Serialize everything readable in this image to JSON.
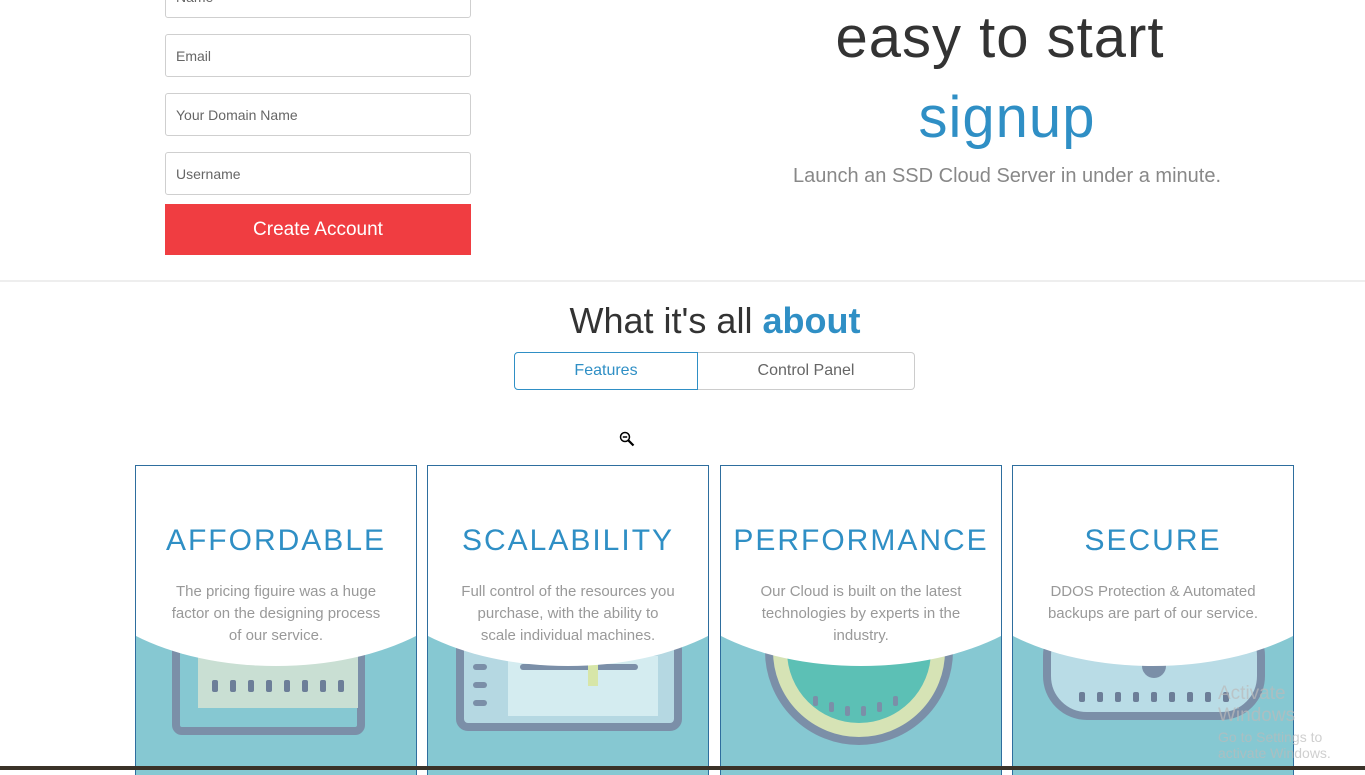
{
  "form": {
    "name_placeholder": "Name",
    "email_placeholder": "Email",
    "domain_placeholder": "Your Domain Name",
    "username_placeholder": "Username",
    "create_label": "Create Account"
  },
  "hero": {
    "line1": "easy to start",
    "line2": "signup",
    "subtitle": "Launch an SSD Cloud Server in under a minute."
  },
  "about": {
    "title_prefix": "What it's all",
    "title_accent": "about",
    "tabs": [
      {
        "label": "Features",
        "active": true
      },
      {
        "label": "Control Panel",
        "active": false
      }
    ]
  },
  "features": [
    {
      "title": "AFFORDABLE",
      "desc": "The pricing figuire was a huge factor on the designing process of our service.",
      "icon": "receipt-icon"
    },
    {
      "title": "SCALABILITY",
      "desc": "Full control of the resources you purchase, with the ability to scale individual machines.",
      "icon": "monitor-icon"
    },
    {
      "title": "PERFORMANCE",
      "desc": "Our Cloud is built on the latest technologies by experts in the industry.",
      "icon": "speedometer-icon"
    },
    {
      "title": "SECURE",
      "desc": "DDOS Protection & Automated backups are part of our service.",
      "icon": "server-icon"
    }
  ],
  "watermark": {
    "line1": "Activate Windows",
    "line2": "Go to Settings to activate Windows."
  },
  "colors": {
    "accent": "#2f8fc5",
    "button": "#f03d41",
    "card_bottom": "#86c8d2"
  }
}
